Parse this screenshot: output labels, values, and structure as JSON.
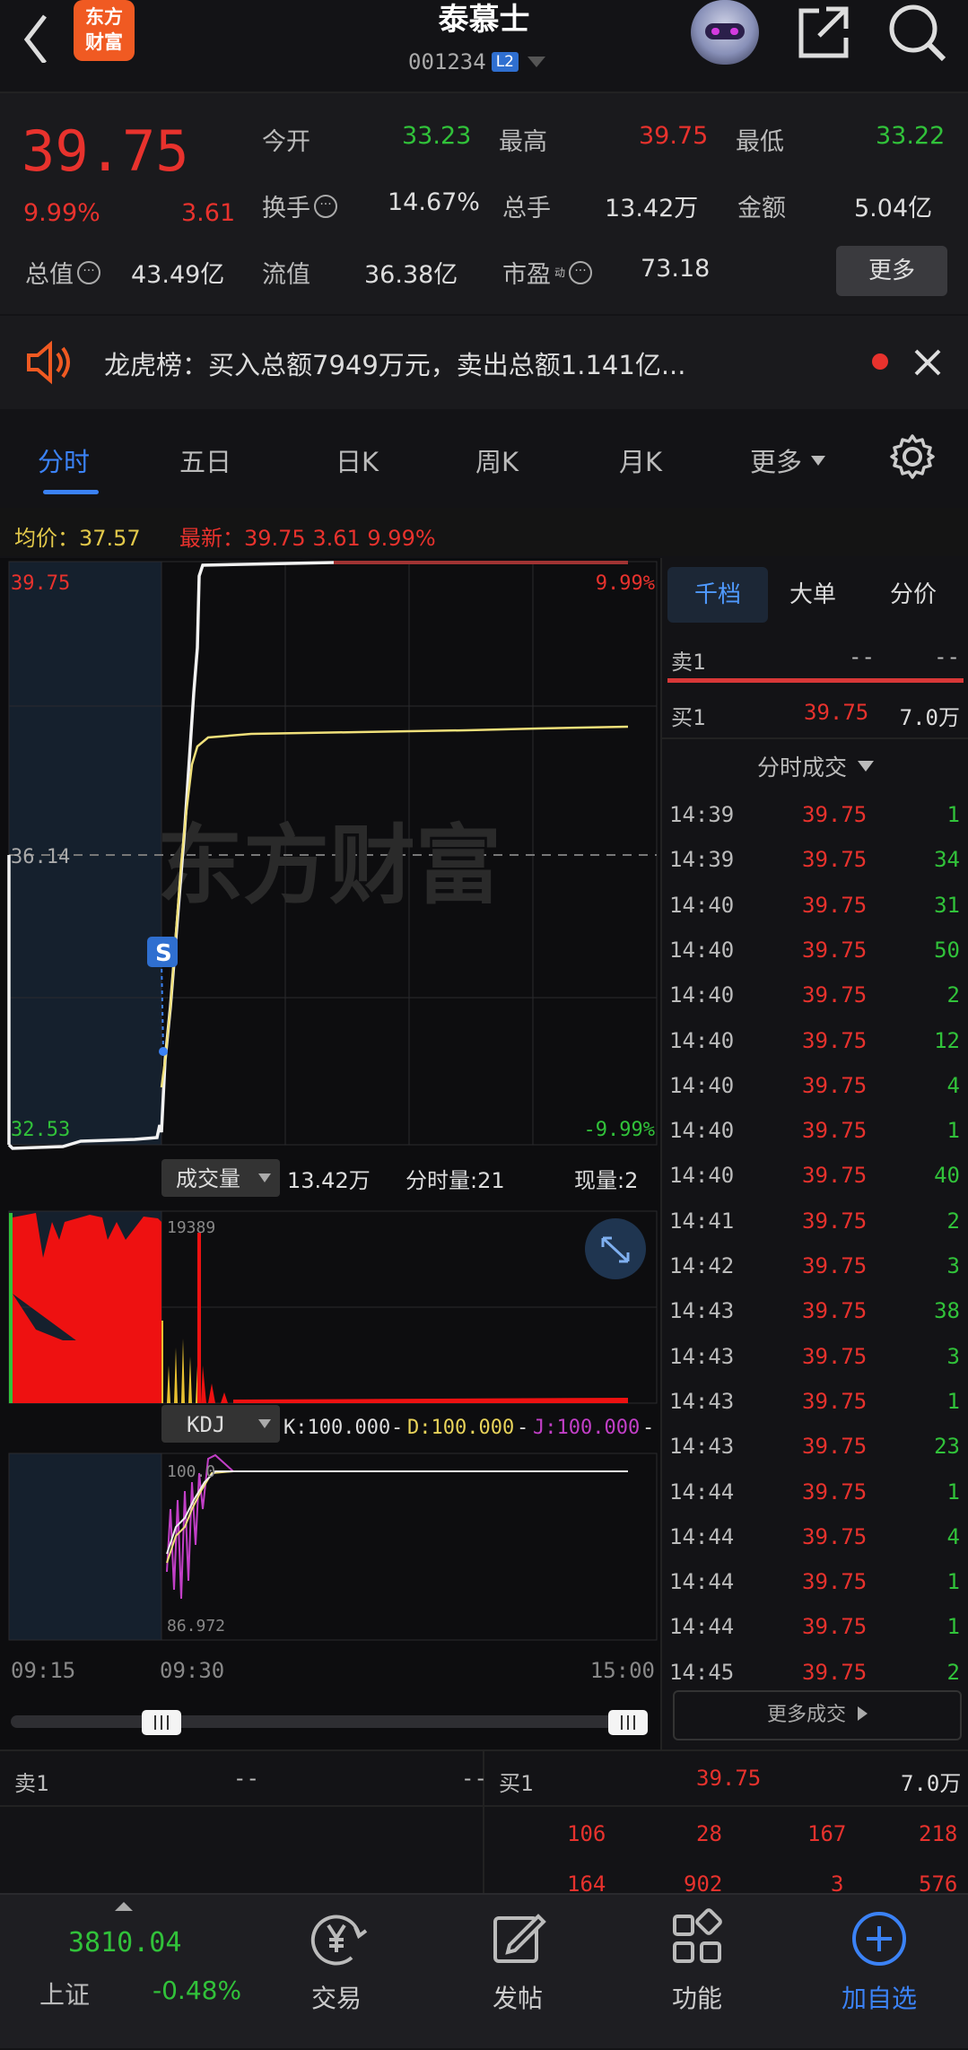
{
  "header": {
    "brand": "东方\n财富",
    "name": "泰慕士",
    "code": "001234",
    "badge": "L2"
  },
  "quote": {
    "price": "39.75",
    "pct": "9.99%",
    "chg": "3.61",
    "open_label": "今开",
    "open": "33.23",
    "high_label": "最高",
    "high": "39.75",
    "low_label": "最低",
    "low": "33.22",
    "turnover_label": "换手",
    "turnover": "14.67%",
    "volume_label": "总手",
    "volume": "13.42万",
    "amount_label": "金额",
    "amount": "5.04亿",
    "mcap_label": "总值",
    "mcap": "43.49亿",
    "float_label": "流值",
    "float": "36.38亿",
    "pe_label": "市盈",
    "pe_sup": "动",
    "pe": "73.18",
    "more": "更多"
  },
  "notice": {
    "text": "龙虎榜：买入总额7949万元，卖出总额1.141亿..."
  },
  "tabs": [
    {
      "label": "分时"
    },
    {
      "label": "五日"
    },
    {
      "label": "日K"
    },
    {
      "label": "周K"
    },
    {
      "label": "月K"
    },
    {
      "label": "更多"
    }
  ],
  "chart_header": {
    "avg": "均价：37.57",
    "latest": "最新：39.75 3.61 9.99%"
  },
  "chart_data": {
    "type": "line",
    "title": "",
    "x": [
      "09:15",
      "09:30",
      "15:00"
    ],
    "ylim": [
      32.53,
      39.75
    ],
    "y_labels": {
      "top": "39.75",
      "mid": "36.14",
      "bottom": "32.53",
      "top_pct": "9.99%",
      "bottom_pct": "-9.99%"
    },
    "series": [
      {
        "name": "最新",
        "color": "#ffffff"
      },
      {
        "name": "均价",
        "color": "#f0e07a",
        "values_note": ""
      }
    ],
    "volume": {
      "label": "成交量",
      "total": "13.42万",
      "per_min": "分时量:21",
      "current": "现量:2",
      "max_label": "19389"
    },
    "kdj": {
      "label": "KDJ",
      "k": "K:100.000",
      "d": "D:100.000",
      "j": "J:100.000",
      "top_label": "100.0",
      "bottom_label": "86.972"
    },
    "time_labels": [
      "09:15",
      "09:30",
      "15:00"
    ]
  },
  "side_tabs": [
    {
      "label": "千档"
    },
    {
      "label": "大单"
    },
    {
      "label": "分价"
    }
  ],
  "sell1": {
    "label": "卖1",
    "price": "--",
    "vol": "--"
  },
  "buy1": {
    "label": "买1",
    "price": "39.75",
    "vol": "7.0万"
  },
  "ticks_title": "分时成交",
  "ticks": [
    {
      "t": "14:39",
      "p": "39.75",
      "v": "1"
    },
    {
      "t": "14:39",
      "p": "39.75",
      "v": "34"
    },
    {
      "t": "14:40",
      "p": "39.75",
      "v": "31"
    },
    {
      "t": "14:40",
      "p": "39.75",
      "v": "50"
    },
    {
      "t": "14:40",
      "p": "39.75",
      "v": "2"
    },
    {
      "t": "14:40",
      "p": "39.75",
      "v": "12"
    },
    {
      "t": "14:40",
      "p": "39.75",
      "v": "4"
    },
    {
      "t": "14:40",
      "p": "39.75",
      "v": "1"
    },
    {
      "t": "14:40",
      "p": "39.75",
      "v": "40"
    },
    {
      "t": "14:41",
      "p": "39.75",
      "v": "2"
    },
    {
      "t": "14:42",
      "p": "39.75",
      "v": "3"
    },
    {
      "t": "14:43",
      "p": "39.75",
      "v": "38"
    },
    {
      "t": "14:43",
      "p": "39.75",
      "v": "3"
    },
    {
      "t": "14:43",
      "p": "39.75",
      "v": "1"
    },
    {
      "t": "14:43",
      "p": "39.75",
      "v": "23"
    },
    {
      "t": "14:44",
      "p": "39.75",
      "v": "1"
    },
    {
      "t": "14:44",
      "p": "39.75",
      "v": "4"
    },
    {
      "t": "14:44",
      "p": "39.75",
      "v": "1"
    },
    {
      "t": "14:44",
      "p": "39.75",
      "v": "1"
    },
    {
      "t": "14:45",
      "p": "39.75",
      "v": "2"
    }
  ],
  "more_ticks": "更多成交",
  "bottom_sell": {
    "label": "卖1",
    "price": "--",
    "vol": "--"
  },
  "bottom_buy": {
    "label": "买1",
    "price": "39.75",
    "vol": "7.0万"
  },
  "queue_row1": [
    "106",
    "28",
    "167",
    "218"
  ],
  "queue_row2": [
    "164",
    "902",
    "3",
    "576"
  ],
  "index": {
    "value": "3810.04",
    "name": "上证",
    "pct": "-0.48%"
  },
  "bottom_nav": [
    {
      "label": "交易"
    },
    {
      "label": "发帖"
    },
    {
      "label": "功能"
    },
    {
      "label": "加自选"
    }
  ],
  "watermark": "东方财富"
}
